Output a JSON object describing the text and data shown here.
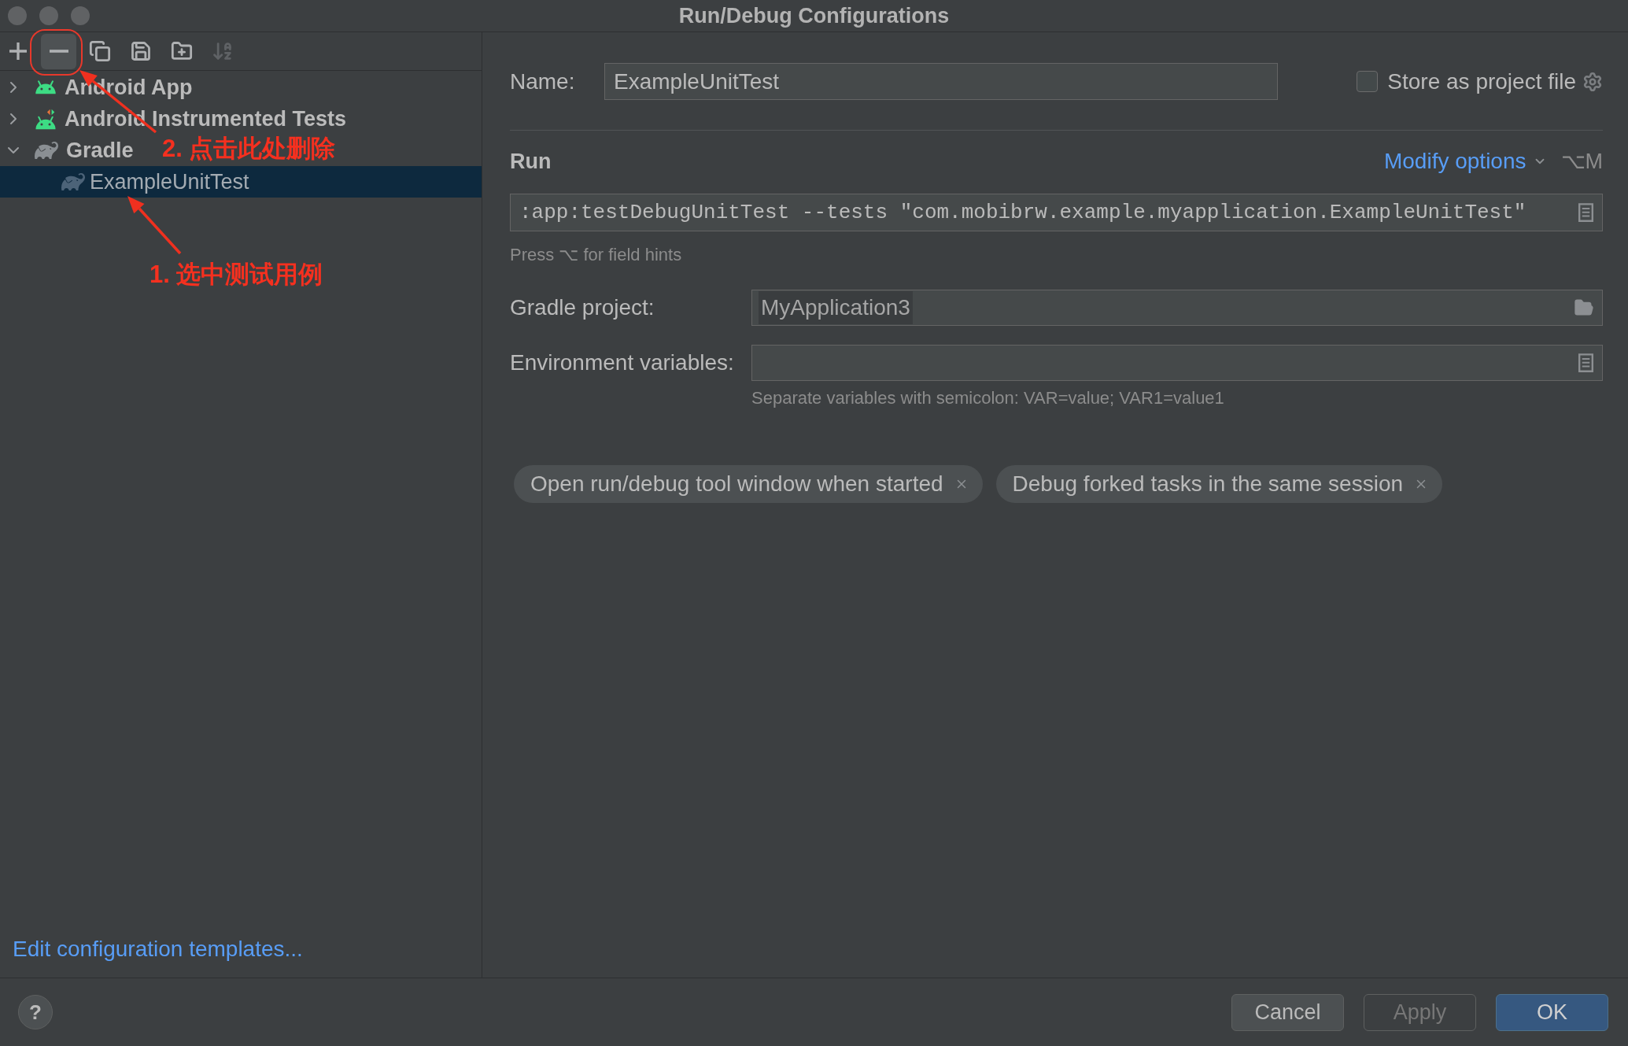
{
  "window": {
    "title": "Run/Debug Configurations"
  },
  "toolbar": [
    {
      "kind": "add",
      "highlighted": false,
      "disabled": false
    },
    {
      "kind": "remove",
      "highlighted": true,
      "disabled": false
    },
    {
      "kind": "copy",
      "highlighted": false,
      "disabled": false
    },
    {
      "kind": "save",
      "highlighted": false,
      "disabled": false
    },
    {
      "kind": "new-folder",
      "highlighted": false,
      "disabled": false
    },
    {
      "kind": "sort",
      "highlighted": false,
      "disabled": true
    }
  ],
  "tree": [
    {
      "label": "Android App",
      "kind": "android",
      "expanded": false,
      "selected": false
    },
    {
      "label": "Android Instrumented Tests",
      "kind": "android-test",
      "expanded": false,
      "selected": false
    },
    {
      "label": "Gradle",
      "kind": "gradle",
      "expanded": true,
      "selected": false,
      "children": [
        {
          "label": "ExampleUnitTest",
          "kind": "gradle",
          "selected": true
        }
      ]
    }
  ],
  "annotations": [
    {
      "text": "2. 点击此处删除"
    },
    {
      "text": "1. 选中测试用例"
    }
  ],
  "templates_link": "Edit configuration templates...",
  "form": {
    "name": {
      "label": "Name:",
      "value": "ExampleUnitTest"
    },
    "store_as_project_file": {
      "label": "Store as project file",
      "checked": false
    },
    "section": "Run",
    "modify_options": {
      "label": "Modify options",
      "shortcut": "⌥M"
    },
    "command": {
      "value": ":app:testDebugUnitTest --tests \"com.mobibrw.example.myapplication.ExampleUnitTest\""
    },
    "field_hint": "Press ⌥ for field hints",
    "gradle_project": {
      "label": "Gradle project:",
      "value": "MyApplication3"
    },
    "environment_variables": {
      "label": "Environment variables:",
      "hint": "Separate variables with semicolon: VAR=value; VAR1=value1"
    }
  },
  "options": [
    {
      "label": "Open run/debug tool window when started"
    },
    {
      "label": "Debug forked tasks in the same session"
    }
  ],
  "help": "?",
  "buttons": [
    {
      "label": "Cancel",
      "kind": "default",
      "disabled": false
    },
    {
      "label": "Apply",
      "kind": "default",
      "disabled": true
    },
    {
      "label": "OK",
      "kind": "primary",
      "disabled": false
    }
  ]
}
